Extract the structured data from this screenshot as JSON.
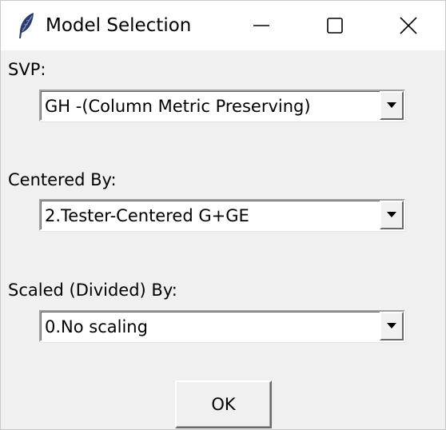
{
  "window": {
    "title": "Model Selection",
    "app_icon": "feather-icon",
    "controls": [
      "minimize-icon",
      "maximize-icon",
      "close-icon"
    ]
  },
  "fields": {
    "svp": {
      "label": "SVP:",
      "value": "GH -(Column Metric Preserving)"
    },
    "centered_by": {
      "label": "Centered By:",
      "value": "2.Tester-Centered G+GE"
    },
    "scaled_by": {
      "label": "Scaled (Divided) By:",
      "value": "0.No scaling"
    }
  },
  "actions": {
    "ok_label": "OK"
  },
  "colors": {
    "window_bg": "#f0f0f0",
    "titlebar_bg": "#ffffff",
    "feather_icon": "#2b3a67"
  }
}
